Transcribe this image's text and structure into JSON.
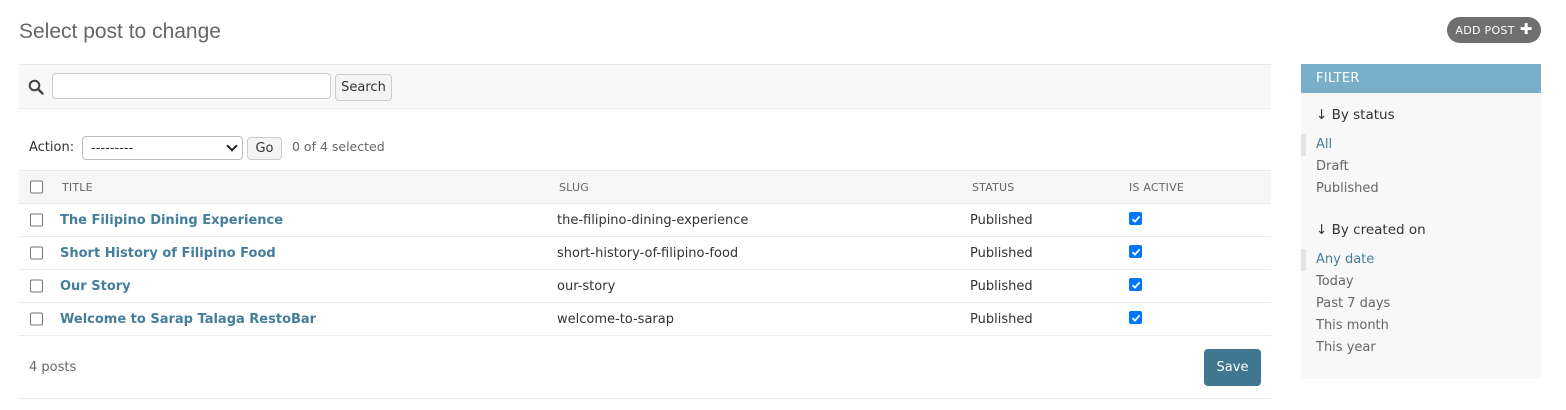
{
  "page": {
    "title": "Select post to change"
  },
  "add_button": {
    "label": "ADD POST"
  },
  "search": {
    "value": "",
    "button_label": "Search"
  },
  "actions": {
    "label": "Action:",
    "selected_option": "---------",
    "go_label": "Go",
    "selected_count": "0 of 4 selected"
  },
  "table": {
    "columns": [
      "TITLE",
      "SLUG",
      "STATUS",
      "IS ACTIVE"
    ],
    "rows": [
      {
        "title": "The Filipino Dining Experience",
        "slug": "the-filipino-dining-experience",
        "status": "Published",
        "is_active": true
      },
      {
        "title": "Short History of Filipino Food",
        "slug": "short-history-of-filipino-food",
        "status": "Published",
        "is_active": true
      },
      {
        "title": "Our Story",
        "slug": "our-story",
        "status": "Published",
        "is_active": true
      },
      {
        "title": "Welcome to Sarap Talaga RestoBar",
        "slug": "welcome-to-sarap",
        "status": "Published",
        "is_active": true
      }
    ]
  },
  "footer": {
    "count": "4 posts",
    "save_label": "Save"
  },
  "filter": {
    "header": "FILTER",
    "groups": [
      {
        "title": "↓ By status",
        "items": [
          "All",
          "Draft",
          "Published"
        ],
        "selected": "All"
      },
      {
        "title": "↓ By created on",
        "items": [
          "Any date",
          "Today",
          "Past 7 days",
          "This month",
          "This year"
        ],
        "selected": "Any date"
      }
    ]
  },
  "colors": {
    "link": "#447e9b",
    "filter_header": "#79aec8",
    "save_button": "#417690",
    "add_button": "#6f6f6f",
    "checkbox_checked": "#0075ff"
  }
}
